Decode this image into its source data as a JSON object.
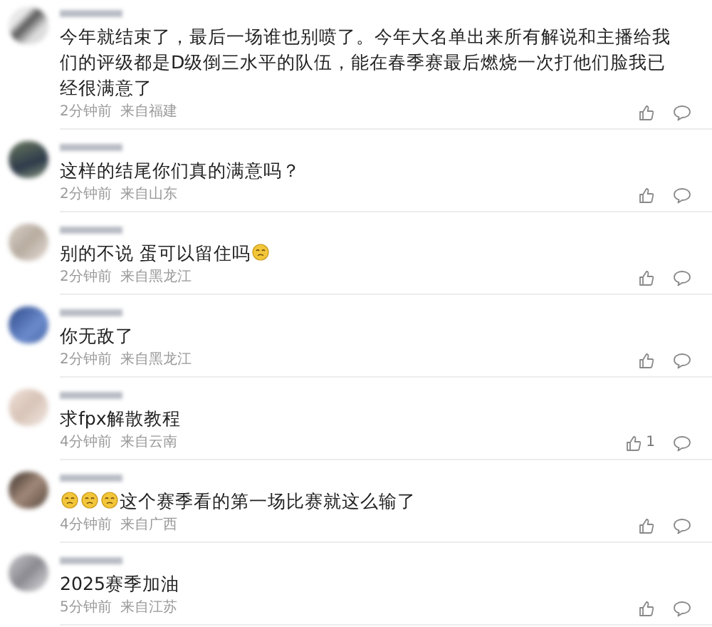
{
  "comments": [
    {
      "parts": [
        {
          "kind": "text",
          "text": "今年就结束了，最后一场谁也别喷了。今年大名单出来所有解说和主播给我们的评级都是D级倒三水平的队伍，能在春季赛最后燃烧一次打他们脸我已经很满意了"
        }
      ],
      "time": "2分钟前",
      "location": "来自福建"
    },
    {
      "parts": [
        {
          "kind": "text",
          "text": "这样的结尾你们真的满意吗？"
        }
      ],
      "time": "2分钟前",
      "location": "来自山东"
    },
    {
      "parts": [
        {
          "kind": "text",
          "text": "别的不说 蛋可以留住吗"
        },
        {
          "kind": "emoji"
        }
      ],
      "time": "2分钟前",
      "location": "来自黑龙江"
    },
    {
      "parts": [
        {
          "kind": "text",
          "text": "你无敌了"
        }
      ],
      "time": "2分钟前",
      "location": "来自黑龙江"
    },
    {
      "parts": [
        {
          "kind": "text",
          "text": "求fpx解散教程"
        }
      ],
      "time": "4分钟前",
      "location": "来自云南",
      "likes": "1"
    },
    {
      "parts": [
        {
          "kind": "emoji"
        },
        {
          "kind": "emoji"
        },
        {
          "kind": "emoji"
        },
        {
          "kind": "text",
          "text": "这个赛季看的第一场比赛就这么输了"
        }
      ],
      "time": "4分钟前",
      "location": "来自广西"
    },
    {
      "parts": [
        {
          "kind": "text",
          "text": "2025赛季加油"
        }
      ],
      "time": "5分钟前",
      "location": "来自江苏"
    }
  ]
}
